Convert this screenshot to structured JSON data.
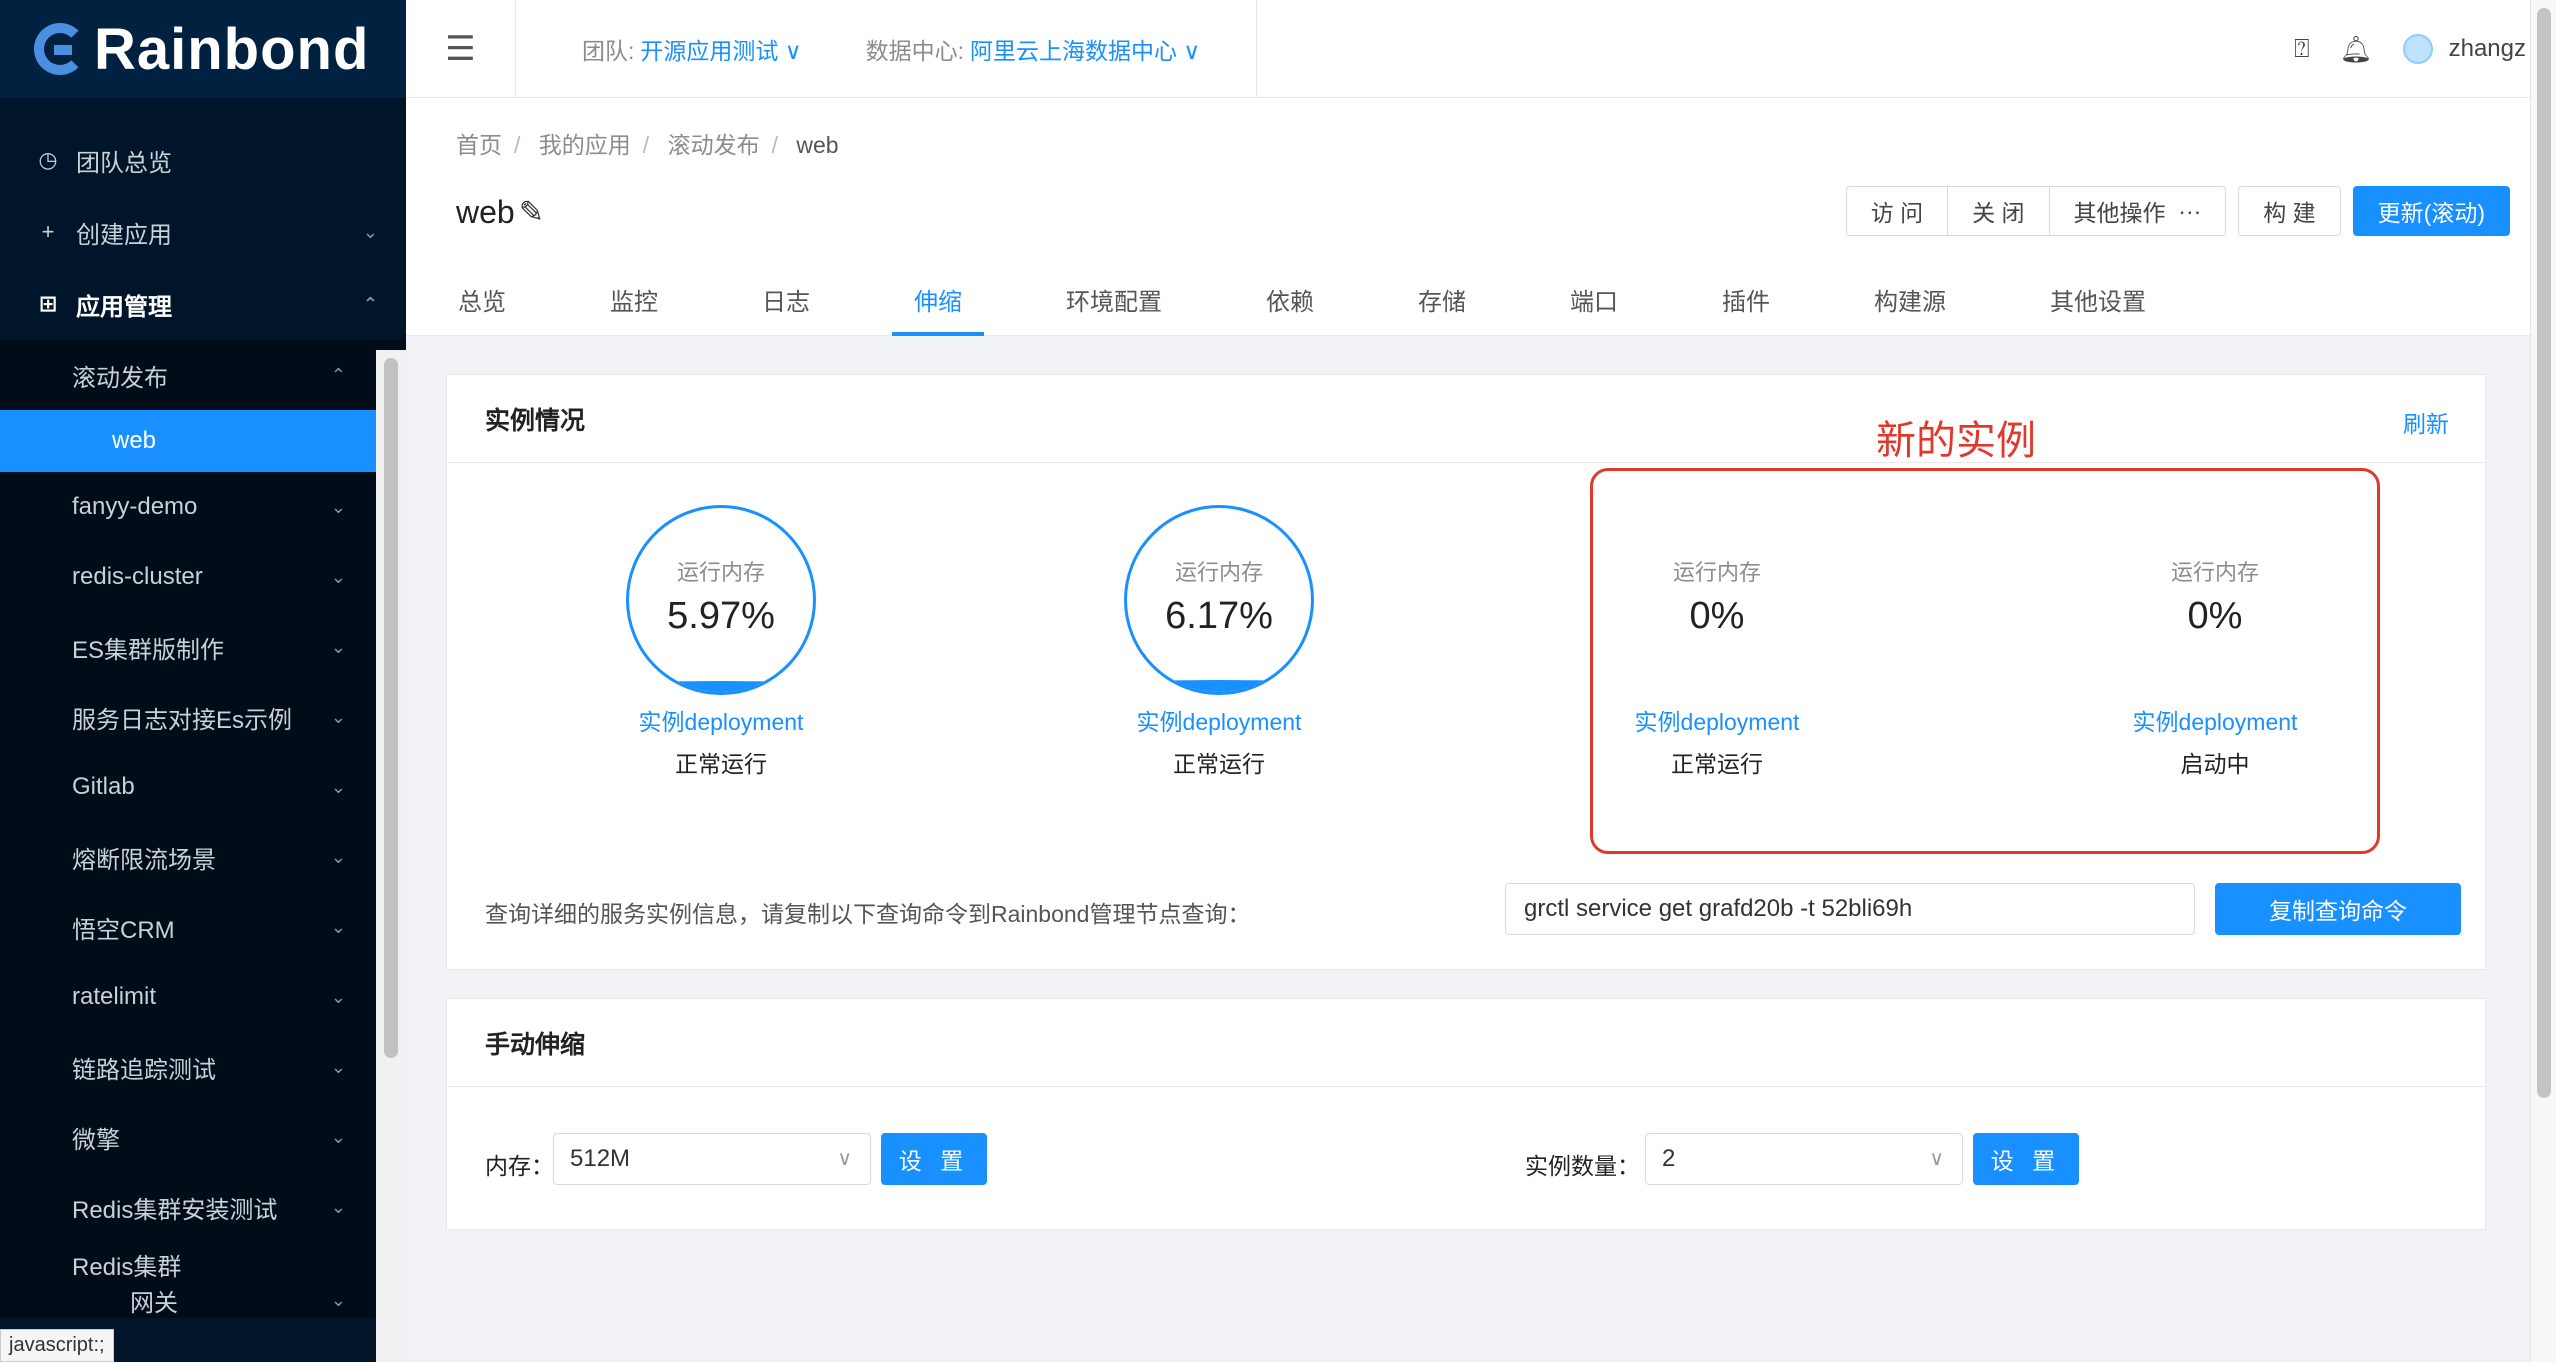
{
  "brand": {
    "name": "Rainbond",
    "accent": "#1890ff"
  },
  "sidebar": {
    "top_items": [
      {
        "label": "团队总览",
        "icon": "dashboard-icon"
      },
      {
        "label": "创建应用",
        "icon": "plus-icon"
      },
      {
        "label": "应用管理",
        "icon": "appstore-icon"
      }
    ],
    "groups": [
      {
        "label": "滚动发布",
        "expanded": true
      },
      {
        "label": "web",
        "selected": true
      },
      {
        "label": "fanyy-demo"
      },
      {
        "label": "redis-cluster"
      },
      {
        "label": "ES集群版制作"
      },
      {
        "label": "服务日志对接Es示例"
      },
      {
        "label": "Gitlab"
      },
      {
        "label": "熔断限流场景"
      },
      {
        "label": "悟空CRM"
      },
      {
        "label": "ratelimit"
      },
      {
        "label": "链路追踪测试"
      },
      {
        "label": "微擎"
      },
      {
        "label": "Redis集群安装测试"
      },
      {
        "label": "Redis集群"
      },
      {
        "label": "网关"
      }
    ],
    "status_url": "javascript:;"
  },
  "header": {
    "team_label": "团队:",
    "team_value": "开源应用测试",
    "dc_label": "数据中心:",
    "dc_value": "阿里云上海数据中心",
    "username": "zhangz"
  },
  "breadcrumb": [
    "首页",
    "我的应用",
    "滚动发布",
    "web"
  ],
  "app": {
    "title": "web"
  },
  "actions": {
    "visit": "访 问",
    "close": "关 闭",
    "more": "其他操作",
    "build": "构 建",
    "update": "更新(滚动)"
  },
  "tabs": [
    "总览",
    "监控",
    "日志",
    "伸缩",
    "环境配置",
    "依赖",
    "存储",
    "端口",
    "插件",
    "构建源",
    "其他设置"
  ],
  "active_tab": "伸缩",
  "instances_card": {
    "title": "实例情况",
    "refresh": "刷新",
    "instances": [
      {
        "mem_label": "运行内存",
        "mem_value": "5.97%",
        "mem_fraction": 0.0597,
        "link": "实例deployment",
        "status": "正常运行"
      },
      {
        "mem_label": "运行内存",
        "mem_value": "6.17%",
        "mem_fraction": 0.0617,
        "link": "实例deployment",
        "status": "正常运行"
      },
      {
        "mem_label": "运行内存",
        "mem_value": "0%",
        "mem_fraction": 0,
        "link": "实例deployment",
        "status": "正常运行"
      },
      {
        "mem_label": "运行内存",
        "mem_value": "0%",
        "mem_fraction": 0,
        "link": "实例deployment",
        "status": "启动中"
      }
    ],
    "annotation": "新的实例",
    "query_label": "查询详细的服务实例信息，请复制以下查询命令到Rainbond管理节点查询：",
    "query_command": "grctl service get grafd20b -t 52bli69h",
    "copy_button": "复制查询命令"
  },
  "scale_card": {
    "title": "手动伸缩",
    "memory_label": "内存：",
    "memory_value": "512M",
    "memory_set": "设 置",
    "count_label": "实例数量：",
    "count_value": "2",
    "count_set": "设 置"
  }
}
